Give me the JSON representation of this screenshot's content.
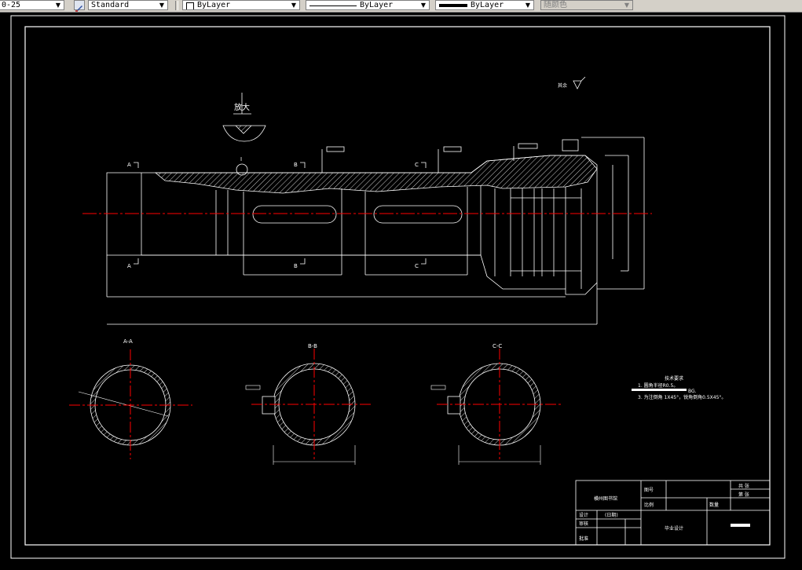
{
  "toolbar": {
    "dimstyle_value": "0-25",
    "textstyle_value": "Standard",
    "layer_value": "ByLayer",
    "linetype_value": "ByLayer",
    "lineweight_value": "ByLayer",
    "color_value": "随颜色"
  },
  "drawing": {
    "zoom_label": "放大",
    "zoom_marker": "I",
    "section_a": "A",
    "section_b": "B",
    "section_c": "C",
    "view_aa": "A-A",
    "view_bb": "B-B",
    "view_cc": "C-C",
    "roughness_note": "其余",
    "tech_title": "技术要求",
    "tech_line1": "1. 圆角半径R0.5。",
    "tech_line2": "BG.",
    "tech_line3": "3. 为注倒角 1X45°，锐角倒角0.5X45°。"
  },
  "title_block": {
    "company": "横州图书馆",
    "qty_label": "图号",
    "scale_label": "比例",
    "material_label": "数量",
    "sheet_label": "共 张",
    "sheet_num_label": "第 张",
    "design_label": "设计",
    "design_date": "(日期)",
    "check_label": "审核",
    "approve_label": "批准",
    "project_name": "毕业设计"
  },
  "colors": {
    "canvas": "#000000",
    "line": "#ffffff",
    "centerline": "#ff0000",
    "toolbar": "#d4d0c8"
  }
}
